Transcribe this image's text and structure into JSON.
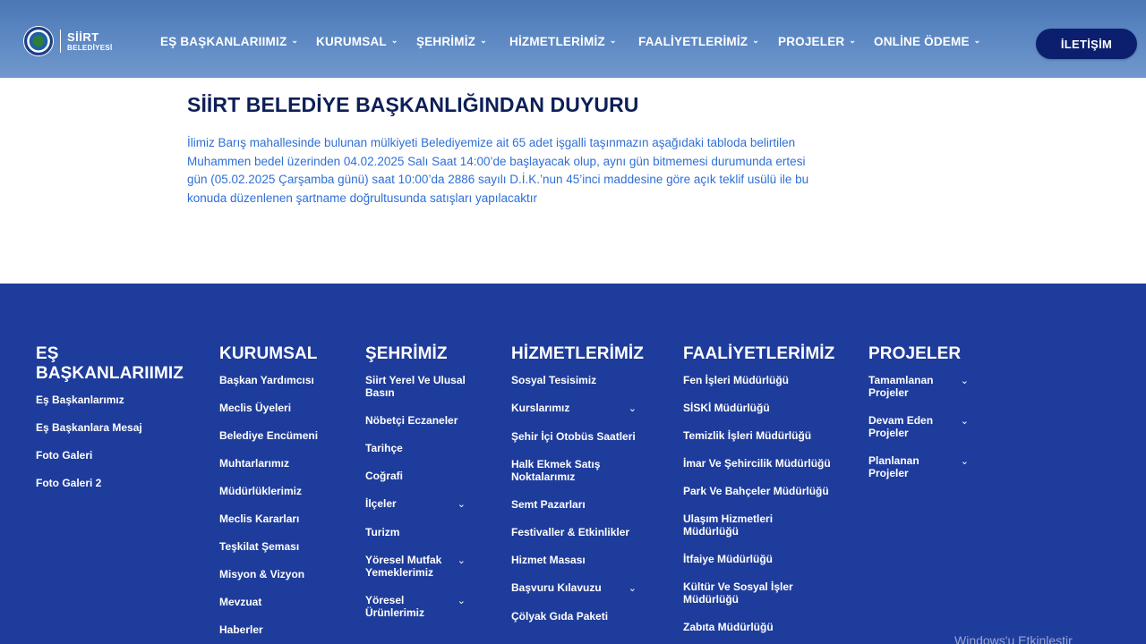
{
  "header": {
    "logo": {
      "line1": "SİİRT",
      "line2": "BELEDİYESİ"
    },
    "nav": [
      {
        "label": "EŞ BAŞKANLARIIMIZ"
      },
      {
        "label": "KURUMSAL"
      },
      {
        "label": "ŞEHRİMİZ"
      },
      {
        "label": "HİZMETLERİMİZ"
      },
      {
        "label": "FAALİYETLERİMİZ"
      },
      {
        "label": "PROJELER"
      },
      {
        "label": "ONLİNE ÖDEME"
      }
    ],
    "chevron": "⌄",
    "contact_label": "İLETİŞİM"
  },
  "content": {
    "title": "SİİRT BELEDİYE BAŞKANLIĞINDAN DUYURU",
    "body": "İlimiz Barış mahallesinde bulunan mülkiyeti Belediyemize ait 65 adet işgalli taşınmazın aşağıdaki tabloda belirtilen Muhammen bedel üzerinden 04.02.2025 Salı Saat 14:00’de başlayacak olup, aynı gün bitmemesi durumunda ertesi gün (05.02.2025 Çarşamba günü) saat 10:00’da 2886 sayılı D.İ.K.’nun 45’inci maddesine göre açık teklif usülü ile bu konuda düzenlenen şartname doğrultusunda satışları yapılacaktır"
  },
  "footer": {
    "columns": [
      {
        "title": "EŞ BAŞKANLARIIMIZ",
        "links": [
          {
            "label": "Eş Başkanlarımız"
          },
          {
            "label": "Eş Başkanlara Mesaj"
          },
          {
            "label": "Foto Galeri"
          },
          {
            "label": "Foto Galeri 2"
          }
        ]
      },
      {
        "title": "KURUMSAL",
        "links": [
          {
            "label": "Başkan Yardımcısı"
          },
          {
            "label": "Meclis Üyeleri"
          },
          {
            "label": "Belediye Encümeni"
          },
          {
            "label": "Muhtarlarımız"
          },
          {
            "label": "Müdürlüklerimiz"
          },
          {
            "label": "Meclis Kararları"
          },
          {
            "label": "Teşkilat Şeması"
          },
          {
            "label": "Misyon & Vizyon"
          },
          {
            "label": "Mevzuat"
          },
          {
            "label": "Haberler"
          }
        ]
      },
      {
        "title": "ŞEHRİMİZ",
        "links": [
          {
            "label": "Siirt Yerel Ve Ulusal Basın"
          },
          {
            "label": "Nöbetçi Eczaneler"
          },
          {
            "label": "Tarihçe"
          },
          {
            "label": "Coğrafi"
          },
          {
            "label": "İlçeler",
            "expand": true
          },
          {
            "label": "Turizm"
          },
          {
            "label": "Yöresel Mutfak Yemeklerimiz",
            "expand": true
          },
          {
            "label": "Yöresel Ürünlerimiz",
            "expand": true
          }
        ]
      },
      {
        "title": "HİZMETLERİMİZ",
        "links": [
          {
            "label": "Sosyal Tesisimiz"
          },
          {
            "label": "Kurslarımız",
            "expand": true
          },
          {
            "label": "Şehir İçi Otobüs Saatleri"
          },
          {
            "label": "Halk Ekmek Satış Noktalarımız"
          },
          {
            "label": "Semt Pazarları"
          },
          {
            "label": "Festivaller & Etkinlikler"
          },
          {
            "label": "Hizmet Masası"
          },
          {
            "label": "Başvuru Kılavuzu",
            "expand": true
          },
          {
            "label": "Çölyak Gıda Paketi"
          }
        ]
      },
      {
        "title": "FAALİYETLERİMİZ",
        "links": [
          {
            "label": "Fen İşleri Müdürlüğü"
          },
          {
            "label": "SİSKİ Müdürlüğü"
          },
          {
            "label": "Temizlik İşleri Müdürlüğü"
          },
          {
            "label": "İmar Ve Şehircilik Müdürlüğü"
          },
          {
            "label": "Park Ve Bahçeler Müdürlüğü"
          },
          {
            "label": "Ulaşım Hizmetleri Müdürlüğü"
          },
          {
            "label": "İtfaiye Müdürlüğü"
          },
          {
            "label": "Kültür Ve Sosyal İşler Müdürlüğü"
          },
          {
            "label": "Zabıta Müdürlüğü"
          }
        ]
      },
      {
        "title": "PROJELER",
        "links": [
          {
            "label": "Tamamlanan Projeler",
            "expand": true
          },
          {
            "label": "Devam Eden Projeler",
            "expand": true
          },
          {
            "label": "Planlanan Projeler",
            "expand": true
          }
        ]
      }
    ],
    "watermark": "Windows'u Etkinleştir"
  }
}
